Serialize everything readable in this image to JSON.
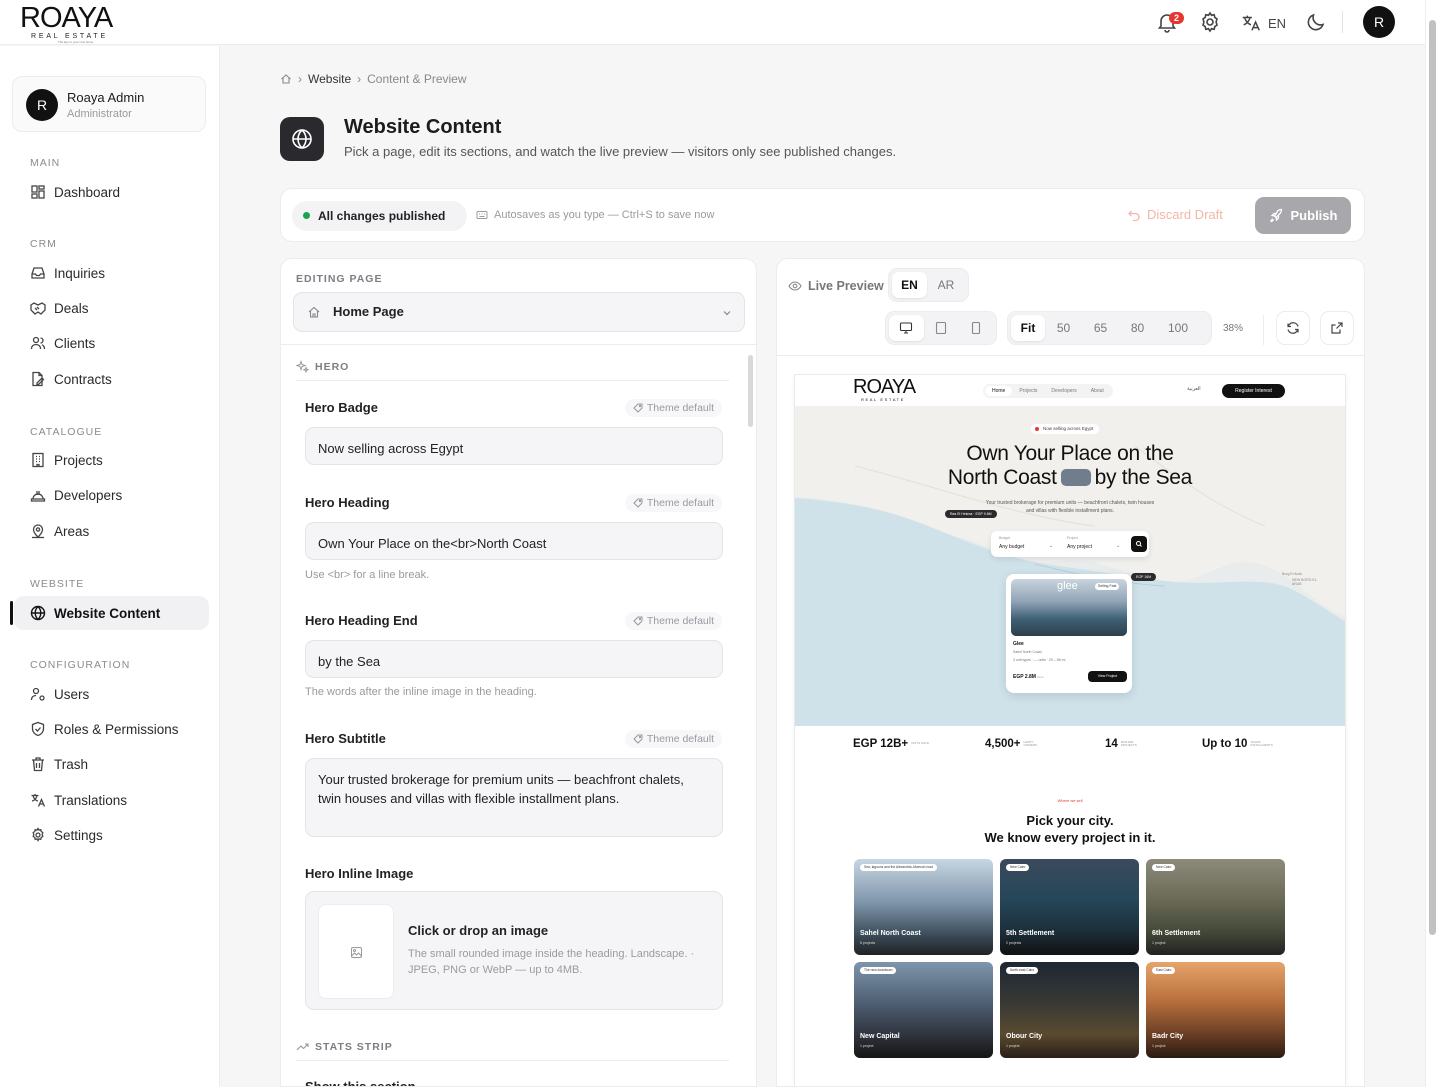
{
  "app": {
    "brand_wordmark": "ROAYA",
    "brand_sub": "REAL ESTATE",
    "brand_tagline": "The key to your new home",
    "notifications_count": "2",
    "language": "EN",
    "user_initial": "R"
  },
  "sidebar": {
    "user": {
      "initial": "R",
      "name": "Roaya Admin",
      "role": "Administrator"
    },
    "sections": {
      "main": "MAIN",
      "crm": "CRM",
      "catalogue": "CATALOGUE",
      "website": "WEBSITE",
      "configuration": "CONFIGURATION"
    },
    "items": {
      "dashboard": "Dashboard",
      "inquiries": "Inquiries",
      "deals": "Deals",
      "clients": "Clients",
      "contracts": "Contracts",
      "projects": "Projects",
      "developers": "Developers",
      "areas": "Areas",
      "website_content": "Website Content",
      "users": "Users",
      "roles": "Roles & Permissions",
      "trash": "Trash",
      "translations": "Translations",
      "settings": "Settings"
    }
  },
  "breadcrumb": {
    "website": "Website",
    "current": "Content & Preview"
  },
  "header": {
    "title": "Website Content",
    "subtitle": "Pick a page, edit its sections, and watch the live preview — visitors only see published changes."
  },
  "status": {
    "published": "All changes published",
    "autosave": "Autosaves as you type — Ctrl+S to save now",
    "discard": "Discard Draft",
    "publish": "Publish"
  },
  "editor": {
    "label": "EDITING PAGE",
    "page": "Home Page",
    "hero_section": "HERO",
    "theme_default": "Theme default",
    "fields": {
      "badge": {
        "label": "Hero Badge",
        "value": "Now selling across Egypt"
      },
      "heading": {
        "label": "Hero Heading",
        "value": "Own Your Place on the<br>North Coast",
        "help": "Use <br> for a line break."
      },
      "heading_end": {
        "label": "Hero Heading End",
        "value": "by the Sea",
        "help": "The words after the inline image in the heading."
      },
      "subtitle": {
        "label": "Hero Subtitle",
        "value": "Your trusted brokerage for premium units — beachfront chalets, twin houses and villas with flexible installment plans."
      },
      "inline_image": {
        "label": "Hero Inline Image",
        "drop_title": "Click or drop an image",
        "drop_help": "The small rounded image inside the heading. Landscape. · JPEG, PNG or WebP — up to 4MB."
      }
    },
    "stats_section": "STATS STRIP",
    "show_section": "Show this section"
  },
  "preview": {
    "label": "Live Preview",
    "langs": [
      "EN",
      "AR"
    ],
    "zoom_options": [
      "Fit",
      "50",
      "65",
      "80",
      "100"
    ],
    "zoom_value": "38%",
    "site": {
      "logo": "ROAYA",
      "logo_sub": "REAL ESTATE",
      "nav": [
        "Home",
        "Projects",
        "Developers",
        "About"
      ],
      "lang_switch": "العربية",
      "cta": "Register Interest",
      "badge": "Now selling across Egypt",
      "heading_1": "Own Your Place on the",
      "heading_2": "North Coast",
      "heading_end": "by the Sea",
      "subtitle": "Your trusted brokerage for premium units — beachfront chalets, twin houses and villas with flexible installment plans.",
      "map_tag_1": "Ras El Hekma · EGP 9.6M",
      "map_tag_2": "EGP 16M",
      "map_place": "NEW BORG EL ARAB",
      "map_place_2": "Borg El Arab",
      "search_budget_label": "Budget",
      "search_budget": "Any budget",
      "search_project_label": "Project",
      "search_project": "Any project",
      "card": {
        "name": "Glee",
        "img_text": "glee",
        "tag": "Selling Fast",
        "location": "Sahel North Coast",
        "facts": "3 unit types · — units · 29 – 86 m²",
        "price": "EGP 2.8M",
        "price_note": "from",
        "button": "View Project"
      },
      "stats": [
        {
          "value": "EGP 12B+",
          "label": "UNITS SOLD"
        },
        {
          "value": "4,500+",
          "label": "HAPPY OWNERS"
        },
        {
          "value": "14",
          "label": "MASTER PROJECTS"
        },
        {
          "value": "Up to 10",
          "label": "YEARS INSTALLMENTS"
        }
      ],
      "cities_eyebrow": "Where we sell",
      "cities_title_1": "Pick your city.",
      "cities_title_2": "We know every project in it.",
      "cities": [
        {
          "tag": "Sea, lagoons and the Alexandria–Matrouh road",
          "name": "Sahel North Coast",
          "count": "8 projects"
        },
        {
          "tag": "New Cairo",
          "name": "5th Settlement",
          "count": "2 projects"
        },
        {
          "tag": "New Cairo",
          "name": "6th Settlement",
          "count": "1 project"
        },
        {
          "tag": "The new downtown",
          "name": "New Capital",
          "count": "1 project"
        },
        {
          "tag": "North-east Cairo",
          "name": "Obour City",
          "count": "1 project"
        },
        {
          "tag": "East Cairo",
          "name": "Badr City",
          "count": "1 project"
        }
      ]
    }
  }
}
